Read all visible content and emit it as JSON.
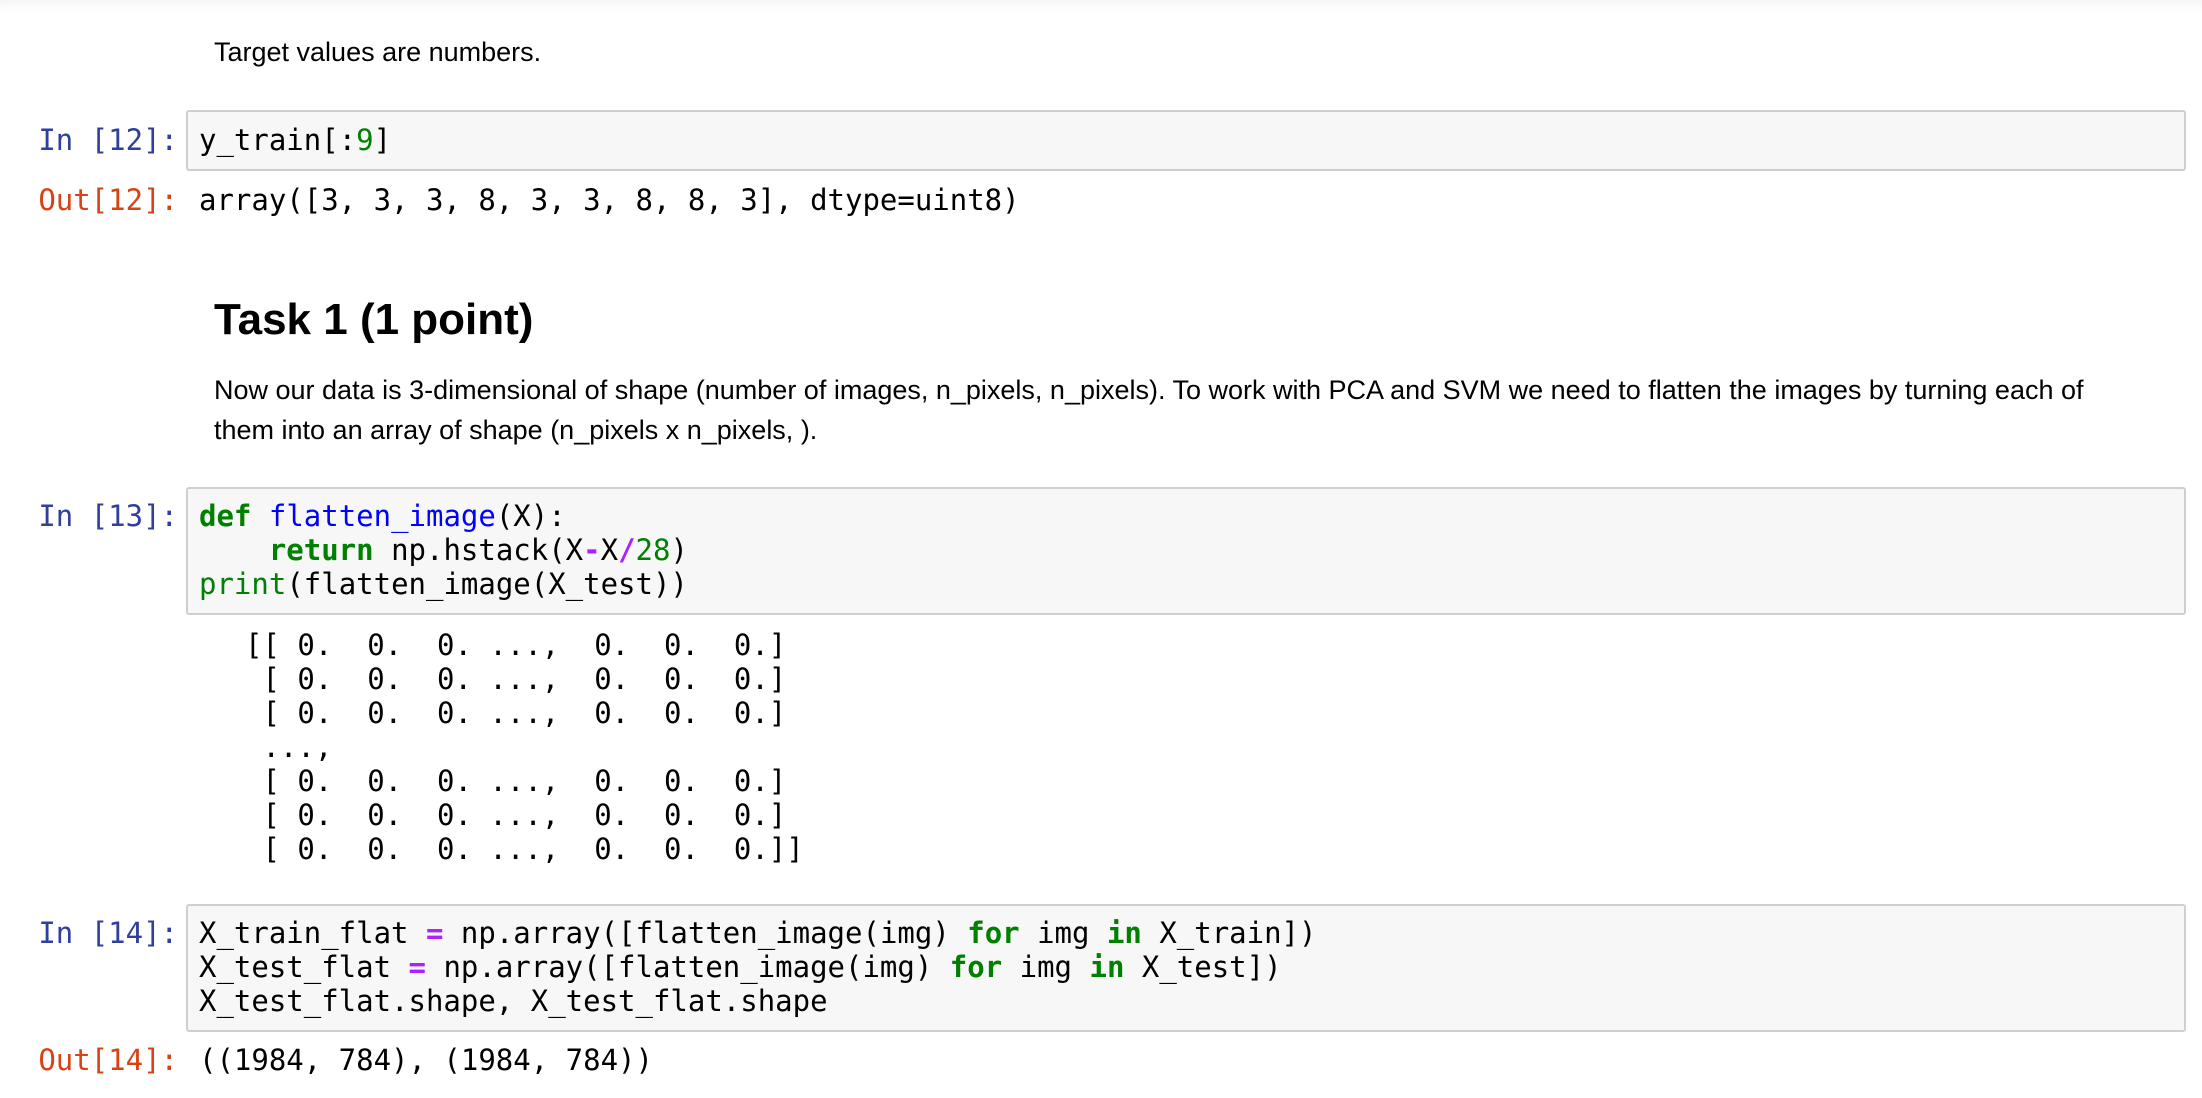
{
  "cells": {
    "md_target": {
      "text": "Target values are numbers."
    },
    "cell12": {
      "in_prompt": "In [12]:",
      "out_prompt": "Out[12]:",
      "code": {
        "var": "y_train",
        "slice_open": "[:",
        "num": "9",
        "slice_close": "]"
      },
      "output": "array([3, 3, 3, 8, 3, 3, 8, 8, 3], dtype=uint8)"
    },
    "md_task1": {
      "heading": "Task 1 (1 point)",
      "line1": "Now our data is 3-dimensional of shape (number of images, n_pixels, n_pixels). To work with PCA and SVM we need to flatten the images by turning each of",
      "line2": "them into an array of shape (n_pixels x n_pixels, )."
    },
    "cell13": {
      "in_prompt": "In [13]:",
      "code": {
        "def_kw": "def",
        "fn_name": "flatten_image",
        "params": "(X):",
        "indent": "    ",
        "return_kw": "return",
        "ret_pre": " np.hstack(X",
        "minus": "-",
        "ret_mid": "X",
        "div": "/",
        "num": "28",
        "ret_close": ")",
        "print_fn": "print",
        "print_args": "(flatten_image(X_test))"
      },
      "output_lines": [
        "[[ 0.  0.  0. ...,  0.  0.  0.]",
        " [ 0.  0.  0. ...,  0.  0.  0.]",
        " [ 0.  0.  0. ...,  0.  0.  0.]",
        " ...,",
        " [ 0.  0.  0. ...,  0.  0.  0.]",
        " [ 0.  0.  0. ...,  0.  0.  0.]",
        " [ 0.  0.  0. ...,  0.  0.  0.]]"
      ]
    },
    "cell14": {
      "in_prompt": "In [14]:",
      "out_prompt": "Out[14]:",
      "code": {
        "l1_var": "X_train_flat ",
        "assign": "=",
        "l1_pre": " np.array([flatten_image(img) ",
        "for_kw": "for",
        "l1_img": " img ",
        "in_kw": "in",
        "l1_post": " X_train])",
        "l2_var": "X_test_flat ",
        "l2_pre": " np.array([flatten_image(img) ",
        "l2_img": " img ",
        "l2_post": " X_test])",
        "l3": "X_test_flat.shape, X_test_flat.shape"
      },
      "output": "((1984, 784), (1984, 784))"
    }
  }
}
